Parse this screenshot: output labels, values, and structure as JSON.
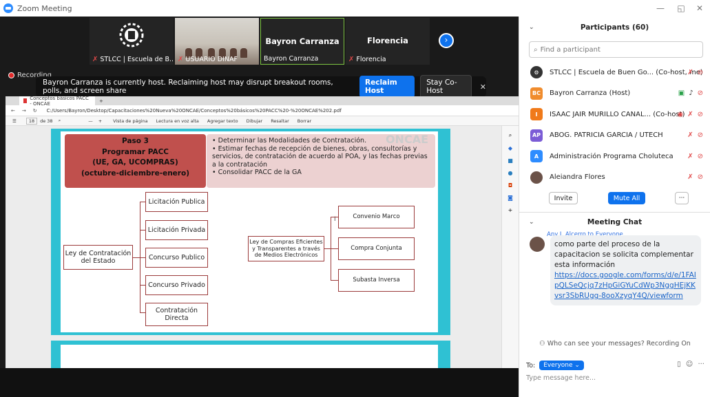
{
  "window": {
    "title": "Zoom Meeting",
    "min": "—",
    "restore": "◱",
    "close": "✕"
  },
  "tiles": [
    {
      "name": "STLCC | Escuela de B..."
    },
    {
      "name": "USUARIO DINAF"
    },
    {
      "name": "Bayron Carranza",
      "big": "Bayron Carranza"
    },
    {
      "name": "Florencia",
      "big": "Florencia"
    }
  ],
  "recording": "Recording",
  "hostbar": {
    "message": "Bayron Carranza is currently host. Reclaiming host may disrupt breakout rooms, polls, and screen share",
    "reclaim": "Reclaim Host",
    "stay": "Stay Co-Host",
    "close": "✕"
  },
  "browser": {
    "tab": "Conceptos básicos PACC - ONCAE",
    "url": "C:/Users/Bayron/Desktop/Capacitaciones%20Nueva%20ONCAE/Conceptos%20básicos%20PACC%20-%20ONCAE%202.pdf",
    "page": "18",
    "of": "de 38",
    "tools": [
      "Vista de página",
      "Lectura en voz alta",
      "Agregar texto",
      "Dibujar",
      "Resaltar",
      "Borrar"
    ]
  },
  "slide": {
    "paso": [
      "Paso 3",
      "Programar PACC",
      "(UE, GA, UCOMPRAS)",
      "(octubre-diciembre-enero)"
    ],
    "bullets": [
      "• Determinar las Modalidades de Contratación.",
      "• Estimar fechas de recepción de bienes, obras, consultorías y servicios, de contratación de acuerdo al POA, y las fechas previas a la contratación",
      "• Consolidar PACC de la GA"
    ],
    "watermark": "ONCAE",
    "left_root": "Ley de Contratación del Estado",
    "left_items": [
      "Licitación Publica",
      "Licitación Privada",
      "Concurso Publico",
      "Concurso Privado",
      "Contratación Directa"
    ],
    "right_root": "Ley de Compras Eficientes y Transparentes a través de Medios Electrónicos",
    "right_items": [
      "Convenio Marco",
      "Compra Conjunta",
      "Subasta Inversa"
    ]
  },
  "participants": {
    "title": "Participants (60)",
    "search_placeholder": "Find a participant",
    "list": [
      {
        "name": "STLCC | Escuela de Buen Go... (Co-host, me)",
        "initials": "",
        "color": "#333333"
      },
      {
        "name": "Bayron Carranza (Host)",
        "initials": "BC",
        "color": "#f08c2d"
      },
      {
        "name": "ISAAC JAIR MURILLO CANAL... (Co-host)",
        "initials": "I",
        "color": "#f07a1a"
      },
      {
        "name": "ABOG. PATRICIA GARCIA / UTECH",
        "initials": "AP",
        "color": "#7b5cd6"
      },
      {
        "name": "Administración Programa Choluteca",
        "initials": "A",
        "color": "#2d8cff"
      },
      {
        "name": "Aleiandra Flores",
        "initials": "",
        "color": "#6b5248"
      }
    ],
    "invite": "Invite",
    "mute_all": "Mute All",
    "more": "···"
  },
  "chat": {
    "title": "Meeting Chat",
    "sender": "Any J. Alcerro to Everyone",
    "message": "como parte del proceso de la capacitacion se solicita complementar esta información",
    "link": "https://docs.google.com/forms/d/e/1FAIpQLSeQcjq7zHpGiGYuCdWp3NggHEjKKvsr3SbRUgg-8ooXzyqY4Q/viewform",
    "who_can_see": "Who can see your messages? Recording On",
    "to_label": "To:",
    "to_value": "Everyone",
    "placeholder": "Type message here..."
  },
  "colors": {
    "accent": "#0e72ed",
    "paso": "#c0504d",
    "slide_border": "#2fc1d3"
  }
}
